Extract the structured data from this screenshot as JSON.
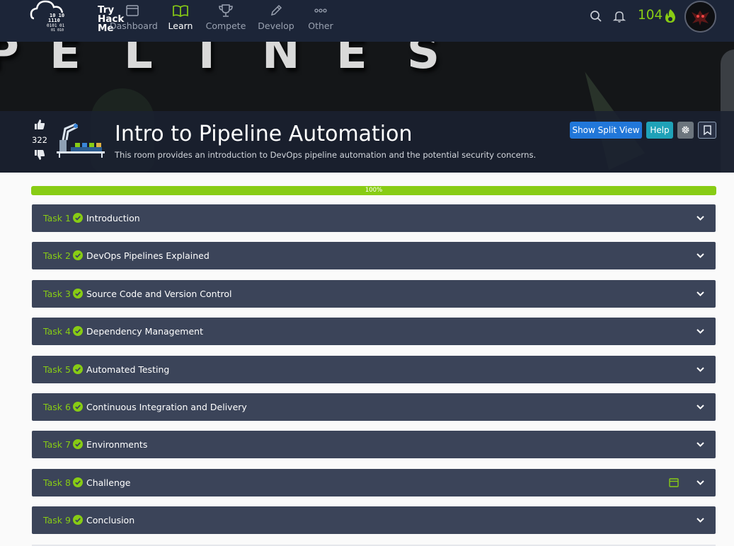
{
  "navbar": {
    "logo_lines": [
      "Try",
      "Hack",
      "Me"
    ],
    "items": [
      {
        "label": "Dashboard",
        "icon": "dashboard-icon",
        "active": false
      },
      {
        "label": "Learn",
        "icon": "book-icon",
        "active": true
      },
      {
        "label": "Compete",
        "icon": "trophy-icon",
        "active": false
      },
      {
        "label": "Develop",
        "icon": "pencil-icon",
        "active": false
      },
      {
        "label": "Other",
        "icon": "dots-icon",
        "active": false
      }
    ],
    "streak": "104",
    "accent_color": "#88cc14"
  },
  "hero": {
    "letters": [
      "P",
      "E",
      "L",
      "I",
      "N",
      "E",
      "S"
    ]
  },
  "room": {
    "votes": "322",
    "title": "Intro to Pipeline Automation",
    "description": "This room provides an introduction to DevOps pipeline automation and the potential security concerns.",
    "buttons": {
      "split_view": "Show Split View",
      "help": "Help"
    }
  },
  "progress": {
    "value_percent": 100,
    "label": "100%"
  },
  "tasks": [
    {
      "number": "Task 1",
      "title": "Introduction",
      "completed": true
    },
    {
      "number": "Task 2",
      "title": "DevOps Pipelines Explained",
      "completed": true
    },
    {
      "number": "Task 3",
      "title": "Source Code and Version Control",
      "completed": true
    },
    {
      "number": "Task 4",
      "title": "Dependency Management",
      "completed": true
    },
    {
      "number": "Task 5",
      "title": "Automated Testing",
      "completed": true
    },
    {
      "number": "Task 6",
      "title": "Continuous Integration and Delivery",
      "completed": true
    },
    {
      "number": "Task 7",
      "title": "Environments",
      "completed": true
    },
    {
      "number": "Task 8",
      "title": "Challenge",
      "completed": true,
      "extra_icon": "browser-window-icon"
    },
    {
      "number": "Task 9",
      "title": "Conclusion",
      "completed": true
    }
  ]
}
